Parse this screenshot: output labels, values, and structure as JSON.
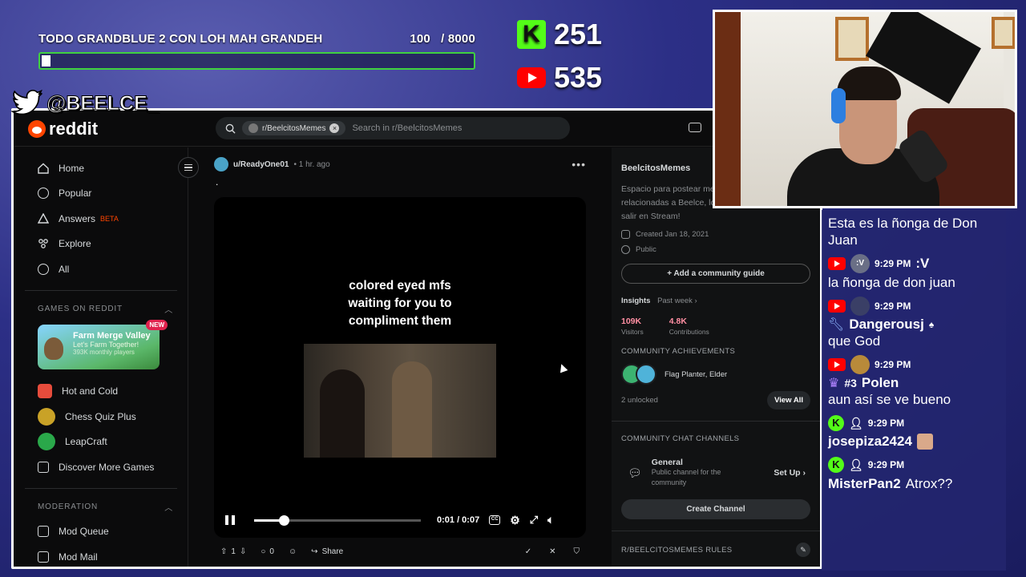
{
  "goal": {
    "title": "TODO GRANDBLUE 2 CON LOH MAH GRANDEH",
    "current": "100",
    "separator": "/",
    "target": "8000",
    "progress": 0.0125
  },
  "counters": {
    "kick": "251",
    "youtube": "535",
    "kick_letter": "K"
  },
  "social": {
    "handle": "@BEELCE_"
  },
  "reddit": {
    "logo": "reddit",
    "search": {
      "community_chip": "r/BeelcitosMemes",
      "placeholder": "Search in r/BeelcitosMemes"
    },
    "nav": [
      {
        "label": "Home",
        "icon": "home-icon"
      },
      {
        "label": "Popular",
        "icon": "popular-icon"
      },
      {
        "label": "Answers",
        "icon": "answers-icon",
        "badge": "BETA"
      },
      {
        "label": "Explore",
        "icon": "explore-icon"
      },
      {
        "label": "All",
        "icon": "all-icon"
      }
    ],
    "games_section": "GAMES ON REDDIT",
    "featured_game": {
      "title": "Farm Merge Valley",
      "subtitle": "Let's Farm Together!",
      "players": "393K monthly players",
      "badge": "NEW"
    },
    "games": [
      {
        "label": "Hot and Cold",
        "color": "#e74c3c"
      },
      {
        "label": "Chess Quiz Plus",
        "color": "#c9a227"
      },
      {
        "label": "LeapCraft",
        "color": "#2aa84a"
      },
      {
        "label": "Discover More Games",
        "color": "#d7dadc"
      }
    ],
    "moderation_section": "MODERATION",
    "mod_items": [
      {
        "label": "Mod Queue"
      },
      {
        "label": "Mod Mail"
      }
    ],
    "post": {
      "user": "u/ReadyOne01",
      "time": "• 1 hr. ago",
      "body_dot": ".",
      "caption_lines": [
        "colored eyed mfs",
        "waiting for you to",
        "compliment them"
      ],
      "video_time": "0:01 / 0:07",
      "video_progress": 0.18,
      "votes": "1",
      "comments": "0",
      "share": "Share"
    },
    "sidebar": {
      "name": "BeelcitosMemes",
      "description_lines": [
        "Espacio para postear me",
        "relacionadas a Beelce, lo",
        "salir en Stream!"
      ],
      "created": "Created Jan 18, 2021",
      "visibility": "Public",
      "guide_button": "+ Add a community guide",
      "insights_label": "Insights",
      "insights_period": "Past week ›",
      "visitors_value": "109K",
      "visitors_label": "Visitors",
      "contrib_value": "4.8K",
      "contrib_label": "Contributions",
      "achievements_title": "COMMUNITY ACHIEVEMENTS",
      "achievements_text": "Flag Planter, Elder",
      "unlocked": "2 unlocked",
      "view_all": "View All",
      "chat_title": "COMMUNITY CHAT CHANNELS",
      "channel_name": "General",
      "channel_desc_lines": [
        "Public channel for the",
        "community"
      ],
      "setup": "Set Up ›",
      "create_channel": "Create Channel",
      "rules_title": "R/BEELCITOSMEMES RULES"
    }
  },
  "chat": [
    {
      "type": "text",
      "text": "Esta es la ñonga de Don Juan"
    },
    {
      "platform": "youtube",
      "time": "9:29 PM",
      "user": ":V",
      "avatar_text": ":V",
      "text": "la ñonga de don juan"
    },
    {
      "platform": "youtube",
      "time": "9:29 PM",
      "user": "Dangerousj",
      "text": "que God"
    },
    {
      "platform": "youtube",
      "time": "9:29 PM",
      "user": "Polen",
      "prefix": "#3",
      "text": "aun así se ve bueno"
    },
    {
      "platform": "kick",
      "time": "9:29 PM",
      "user": "josepiza2424",
      "text": ""
    },
    {
      "platform": "kick",
      "time": "9:29 PM",
      "user": "MisterPan2",
      "text": "Atrox??"
    }
  ]
}
